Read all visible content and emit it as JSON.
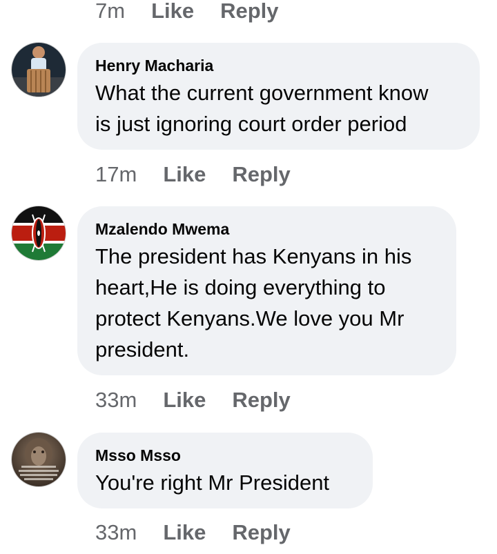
{
  "top_actions": {
    "time": "7m",
    "like": "Like",
    "reply": "Reply"
  },
  "comments": [
    {
      "author": "Henry Macharia",
      "text": "What the current government know is just ignoring court order period",
      "lines": [
        "What the current government know",
        "is just ignoring court order period"
      ],
      "time": "17m",
      "like": "Like",
      "reply": "Reply",
      "avatar": "person-sitting-photo"
    },
    {
      "author": "Mzalendo Mwema",
      "text": "The president has Kenyans in his heart,He is doing everything to protect Kenyans.We love you Mr president.",
      "lines": [
        "The president has Kenyans in his",
        "heart,He is doing everything to",
        "protect Kenyans.We love you Mr",
        "president."
      ],
      "time": "33m",
      "like": "Like",
      "reply": "Reply",
      "avatar": "kenya-flag"
    },
    {
      "author": "Msso Msso",
      "text": "You're right Mr President",
      "lines": [
        "You're right Mr President"
      ],
      "time": "33m",
      "like": "Like",
      "reply": "Reply",
      "avatar": "lion-quote-image"
    }
  ],
  "colors": {
    "bubble": "#f0f2f5",
    "meta_text": "#65676b",
    "body_text": "#050505"
  }
}
